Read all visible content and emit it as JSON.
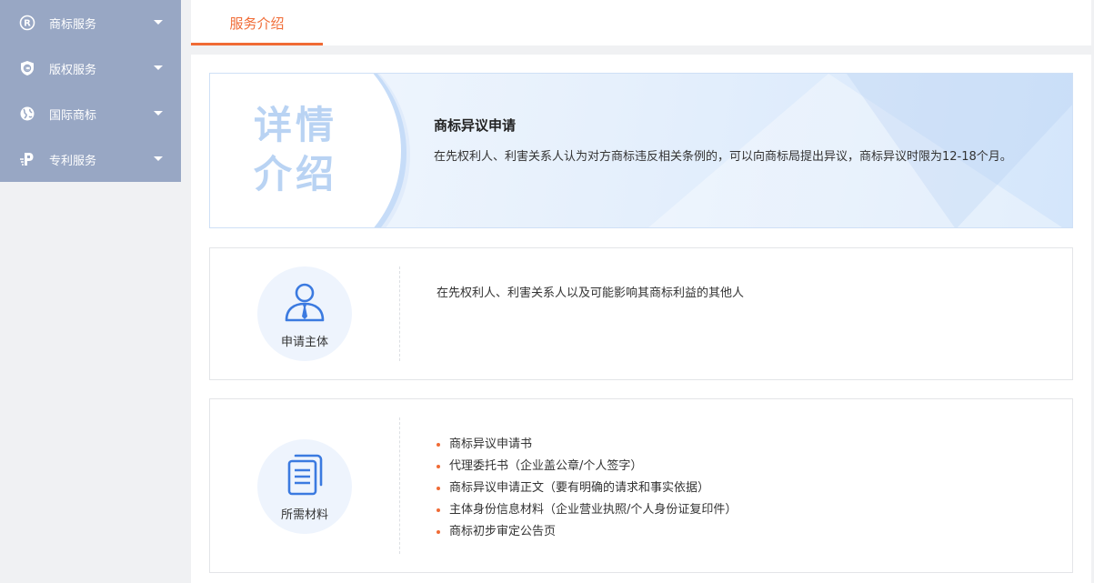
{
  "sidebar": {
    "items": [
      {
        "label": "商标服务",
        "icon": "registered-icon"
      },
      {
        "label": "版权服务",
        "icon": "copyright-shield-icon"
      },
      {
        "label": "国际商标",
        "icon": "globe-icon"
      },
      {
        "label": "专利服务",
        "icon": "patent-icon"
      }
    ]
  },
  "tabs": [
    {
      "label": "服务介绍"
    }
  ],
  "banner": {
    "badge_line1": "详情",
    "badge_line2": "介绍",
    "title": "商标异议申请",
    "description": "在先权利人、利害关系人认为对方商标违反相关条例的，可以向商标局提出异议，商标异议时限为12-18个月。"
  },
  "applicant": {
    "label": "申请主体",
    "icon": "person-icon",
    "text": "在先权利人、利害关系人以及可能影响其商标利益的其他人"
  },
  "materials": {
    "label": "所需材料",
    "icon": "documents-icon",
    "items": [
      "商标异议申请书",
      "代理委托书（企业盖公章/个人签字）",
      "商标异议申请正文（要有明确的请求和事实依据）",
      "主体身份信息材料（企业营业执照/个人身份证复印件）",
      "商标初步审定公告页"
    ]
  },
  "colors": {
    "accent": "#f06b35",
    "sidebar_bg": "#98a7c4",
    "icon_blue": "#3b7ae0"
  }
}
